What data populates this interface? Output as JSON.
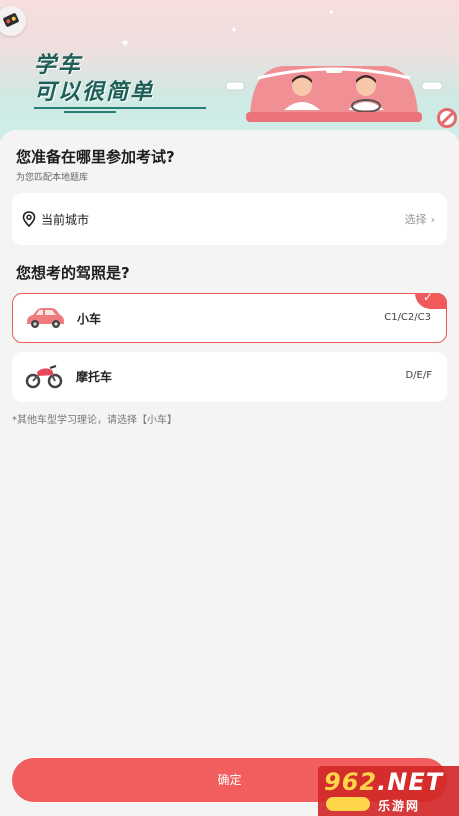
{
  "banner": {
    "slogan_line1": "学车",
    "slogan_line2": "可以很简单",
    "icons": [
      "traffic-light-icon",
      "car-driving-illustration",
      "no-entry-icon"
    ]
  },
  "city_section": {
    "title": "您准备在哪里参加考试?",
    "subtitle": "为您匹配本地题库",
    "current_city_label": "当前城市",
    "select_label": "选择",
    "chevron": "›"
  },
  "license_section": {
    "title": "您想考的驾照是?",
    "options": [
      {
        "name": "小车",
        "types": "C1/C2/C3",
        "selected": true,
        "icon": "car-icon"
      },
      {
        "name": "摩托车",
        "types": "D/E/F",
        "selected": false,
        "icon": "motorcycle-icon"
      }
    ],
    "note": "*其他车型学习理论，请选择【小车】"
  },
  "confirm_label": "确定",
  "watermark": {
    "prefix": "",
    "number": "962",
    "suffix": ".NET",
    "site": "乐游网"
  },
  "colors": {
    "accent": "#f25e5e",
    "background": "#f4f4f5",
    "slogan": "#1e5f59"
  }
}
